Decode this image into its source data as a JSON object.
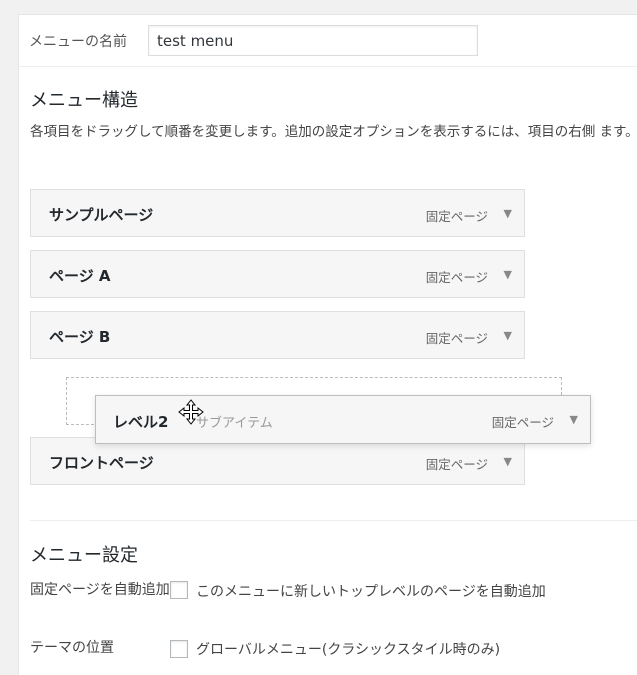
{
  "menu_name": {
    "label": "メニューの名前",
    "value": "test menu"
  },
  "structure": {
    "heading": "メニュー構造",
    "description": "各項目をドラッグして順番を変更します。追加の設定オプションを表示するには、項目の右側 ます。"
  },
  "menu_items": [
    {
      "title": "サンプルページ",
      "type": "固定ページ"
    },
    {
      "title": "ページ A",
      "type": "固定ページ"
    },
    {
      "title": "ページ B",
      "type": "固定ページ"
    },
    {
      "title": "フロントページ",
      "type": "固定ページ"
    }
  ],
  "dragging_item": {
    "title": "レベル2",
    "sub_label": "サブアイテム",
    "type": "固定ページ"
  },
  "settings": {
    "heading": "メニュー設定",
    "auto_add_label": "固定ページを自動追加",
    "auto_add_text": "このメニューに新しいトップレベルのページを自動追加",
    "theme_location_label": "テーマの位置",
    "theme_location_text": "グローバルメニュー(クラシックスタイル時のみ)"
  },
  "icons": {
    "item_toggle": "triangle-down-icon",
    "cursor": "move-cursor-icon"
  },
  "colors": {
    "item_bg": "#f6f6f6",
    "border": "#dfdfdf",
    "panel_bg": "#ffffff",
    "page_bg": "#f1f1f1"
  }
}
